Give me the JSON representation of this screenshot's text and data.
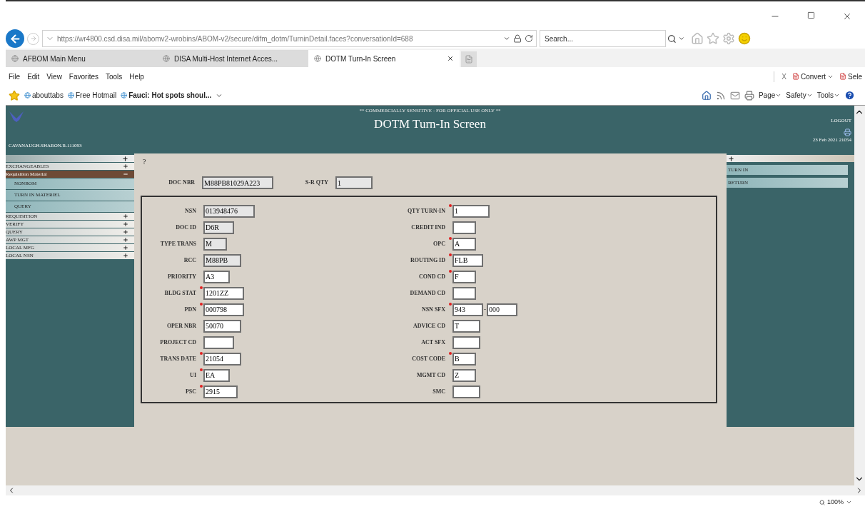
{
  "browser": {
    "url": "https://wr4800.csd.disa.mil/abomv2-wrobins/ABOM-v2/secure/difm_dotm/TurninDetail.faces?conversationId=688",
    "search": {
      "placeholder": "Search..."
    },
    "tabs": [
      {
        "label": "AFBOM Main Menu",
        "selected": false
      },
      {
        "label": "DISA Multi-Host Internet Acces...",
        "selected": false
      },
      {
        "label": "DOTM Turn-In Screen",
        "selected": true
      }
    ],
    "menu": [
      "File",
      "Edit",
      "View",
      "Favorites",
      "Tools",
      "Help"
    ],
    "toolbar_close": "X",
    "toolbar_buttons": [
      "Convert",
      "Sele"
    ],
    "favorites": [
      {
        "label": "abouttabs",
        "bold": false
      },
      {
        "label": "Free Hotmail",
        "bold": false
      },
      {
        "label": "Fauci: Hot spots shoul...",
        "bold": true
      }
    ],
    "command_bar": [
      "Page",
      "Safety",
      "Tools"
    ],
    "zoom": "100%"
  },
  "page": {
    "banner": "** COMMERCIALLY SENSITIVE - FOR OFFICIAL USE ONLY **",
    "title": "DOTM Turn-In Screen",
    "user": "CAVANAUGH.SHARON.R.111093",
    "logout": "LOGOUT",
    "date": "23 Feb 2021 21054",
    "sidebar": {
      "items": [
        {
          "label": "EXCHANGEABLES",
          "selected": false,
          "expanded": false
        },
        {
          "label": "Requisition Material",
          "selected": true,
          "expanded": true,
          "children": [
            {
              "label": "NONBOM"
            },
            {
              "label": "TURN IN MATERIEL"
            },
            {
              "label": "QUERY"
            }
          ]
        },
        {
          "label": "REQUISITION",
          "selected": false,
          "expanded": false
        },
        {
          "label": "VERIFY",
          "selected": false,
          "expanded": false
        },
        {
          "label": "QUERY",
          "selected": false,
          "expanded": false
        },
        {
          "label": "AWP MGT",
          "selected": false,
          "expanded": false
        },
        {
          "label": "LOCAL MFG",
          "selected": false,
          "expanded": false
        },
        {
          "label": "LOCAL NSN",
          "selected": false,
          "expanded": false
        }
      ]
    },
    "right_panel": {
      "items": [
        {
          "label": "TURN IN"
        },
        {
          "label": "RETURN"
        }
      ]
    },
    "help": "?",
    "top_fields": [
      {
        "label": "DOC NBR",
        "value": "M88PB81029A223",
        "required": false,
        "readonly": true
      },
      {
        "label": "S-R QTY",
        "value": "1",
        "required": false,
        "readonly": true
      }
    ],
    "left_fields": [
      {
        "label": "NSN",
        "value": "013948476",
        "required": false,
        "readonly": true
      },
      {
        "label": "DOC ID",
        "value": "D6R",
        "required": false,
        "readonly": true
      },
      {
        "label": "TYPE TRANS",
        "value": "M",
        "required": false,
        "readonly": true
      },
      {
        "label": "RCC",
        "value": "M88PB",
        "required": false,
        "readonly": true
      },
      {
        "label": "PRIORITY",
        "value": "A3",
        "required": false,
        "readonly": false
      },
      {
        "label": "BLDG STAT",
        "value": "1201ZZ",
        "required": true,
        "readonly": false
      },
      {
        "label": "PDN",
        "value": "000798",
        "required": true,
        "readonly": false
      },
      {
        "label": "OPER NBR",
        "value": "50070",
        "required": false,
        "readonly": false
      },
      {
        "label": "PROJECT CD",
        "required": false,
        "readonly": false
      },
      {
        "label": "TRANS DATE",
        "value": "21054",
        "required": true,
        "readonly": false
      },
      {
        "label": "UI",
        "value": "EA",
        "required": true,
        "readonly": false
      },
      {
        "label": "PSC",
        "value": "2915",
        "required": true,
        "readonly": false
      }
    ],
    "right_fields": [
      {
        "label": "QTY TURN-IN",
        "value": "1",
        "required": true,
        "readonly": false
      },
      {
        "label": "CREDIT IND",
        "required": false,
        "readonly": false
      },
      {
        "label": "OPC",
        "value": "A",
        "required": true,
        "readonly": false
      },
      {
        "label": "ROUTING ID",
        "value": "FLB",
        "required": true,
        "readonly": false
      },
      {
        "label": "COND CD",
        "value": "F",
        "required": true,
        "readonly": false
      },
      {
        "label": "DEMAND CD",
        "required": false,
        "readonly": false
      },
      {
        "label": "NSN SFX",
        "value": "943",
        "required": true,
        "readonly": false,
        "suffix": {
          "separator": "-",
          "value": "000"
        }
      },
      {
        "label": "ADVICE CD",
        "value": "T",
        "required": false,
        "readonly": false
      },
      {
        "label": "ACT SFX",
        "required": false,
        "readonly": false
      },
      {
        "label": "COST CODE",
        "value": "B",
        "required": true,
        "readonly": false
      },
      {
        "label": "MGMT CD",
        "value": "Z",
        "required": false,
        "readonly": false
      },
      {
        "label": "SMC",
        "required": false,
        "readonly": false
      }
    ]
  }
}
